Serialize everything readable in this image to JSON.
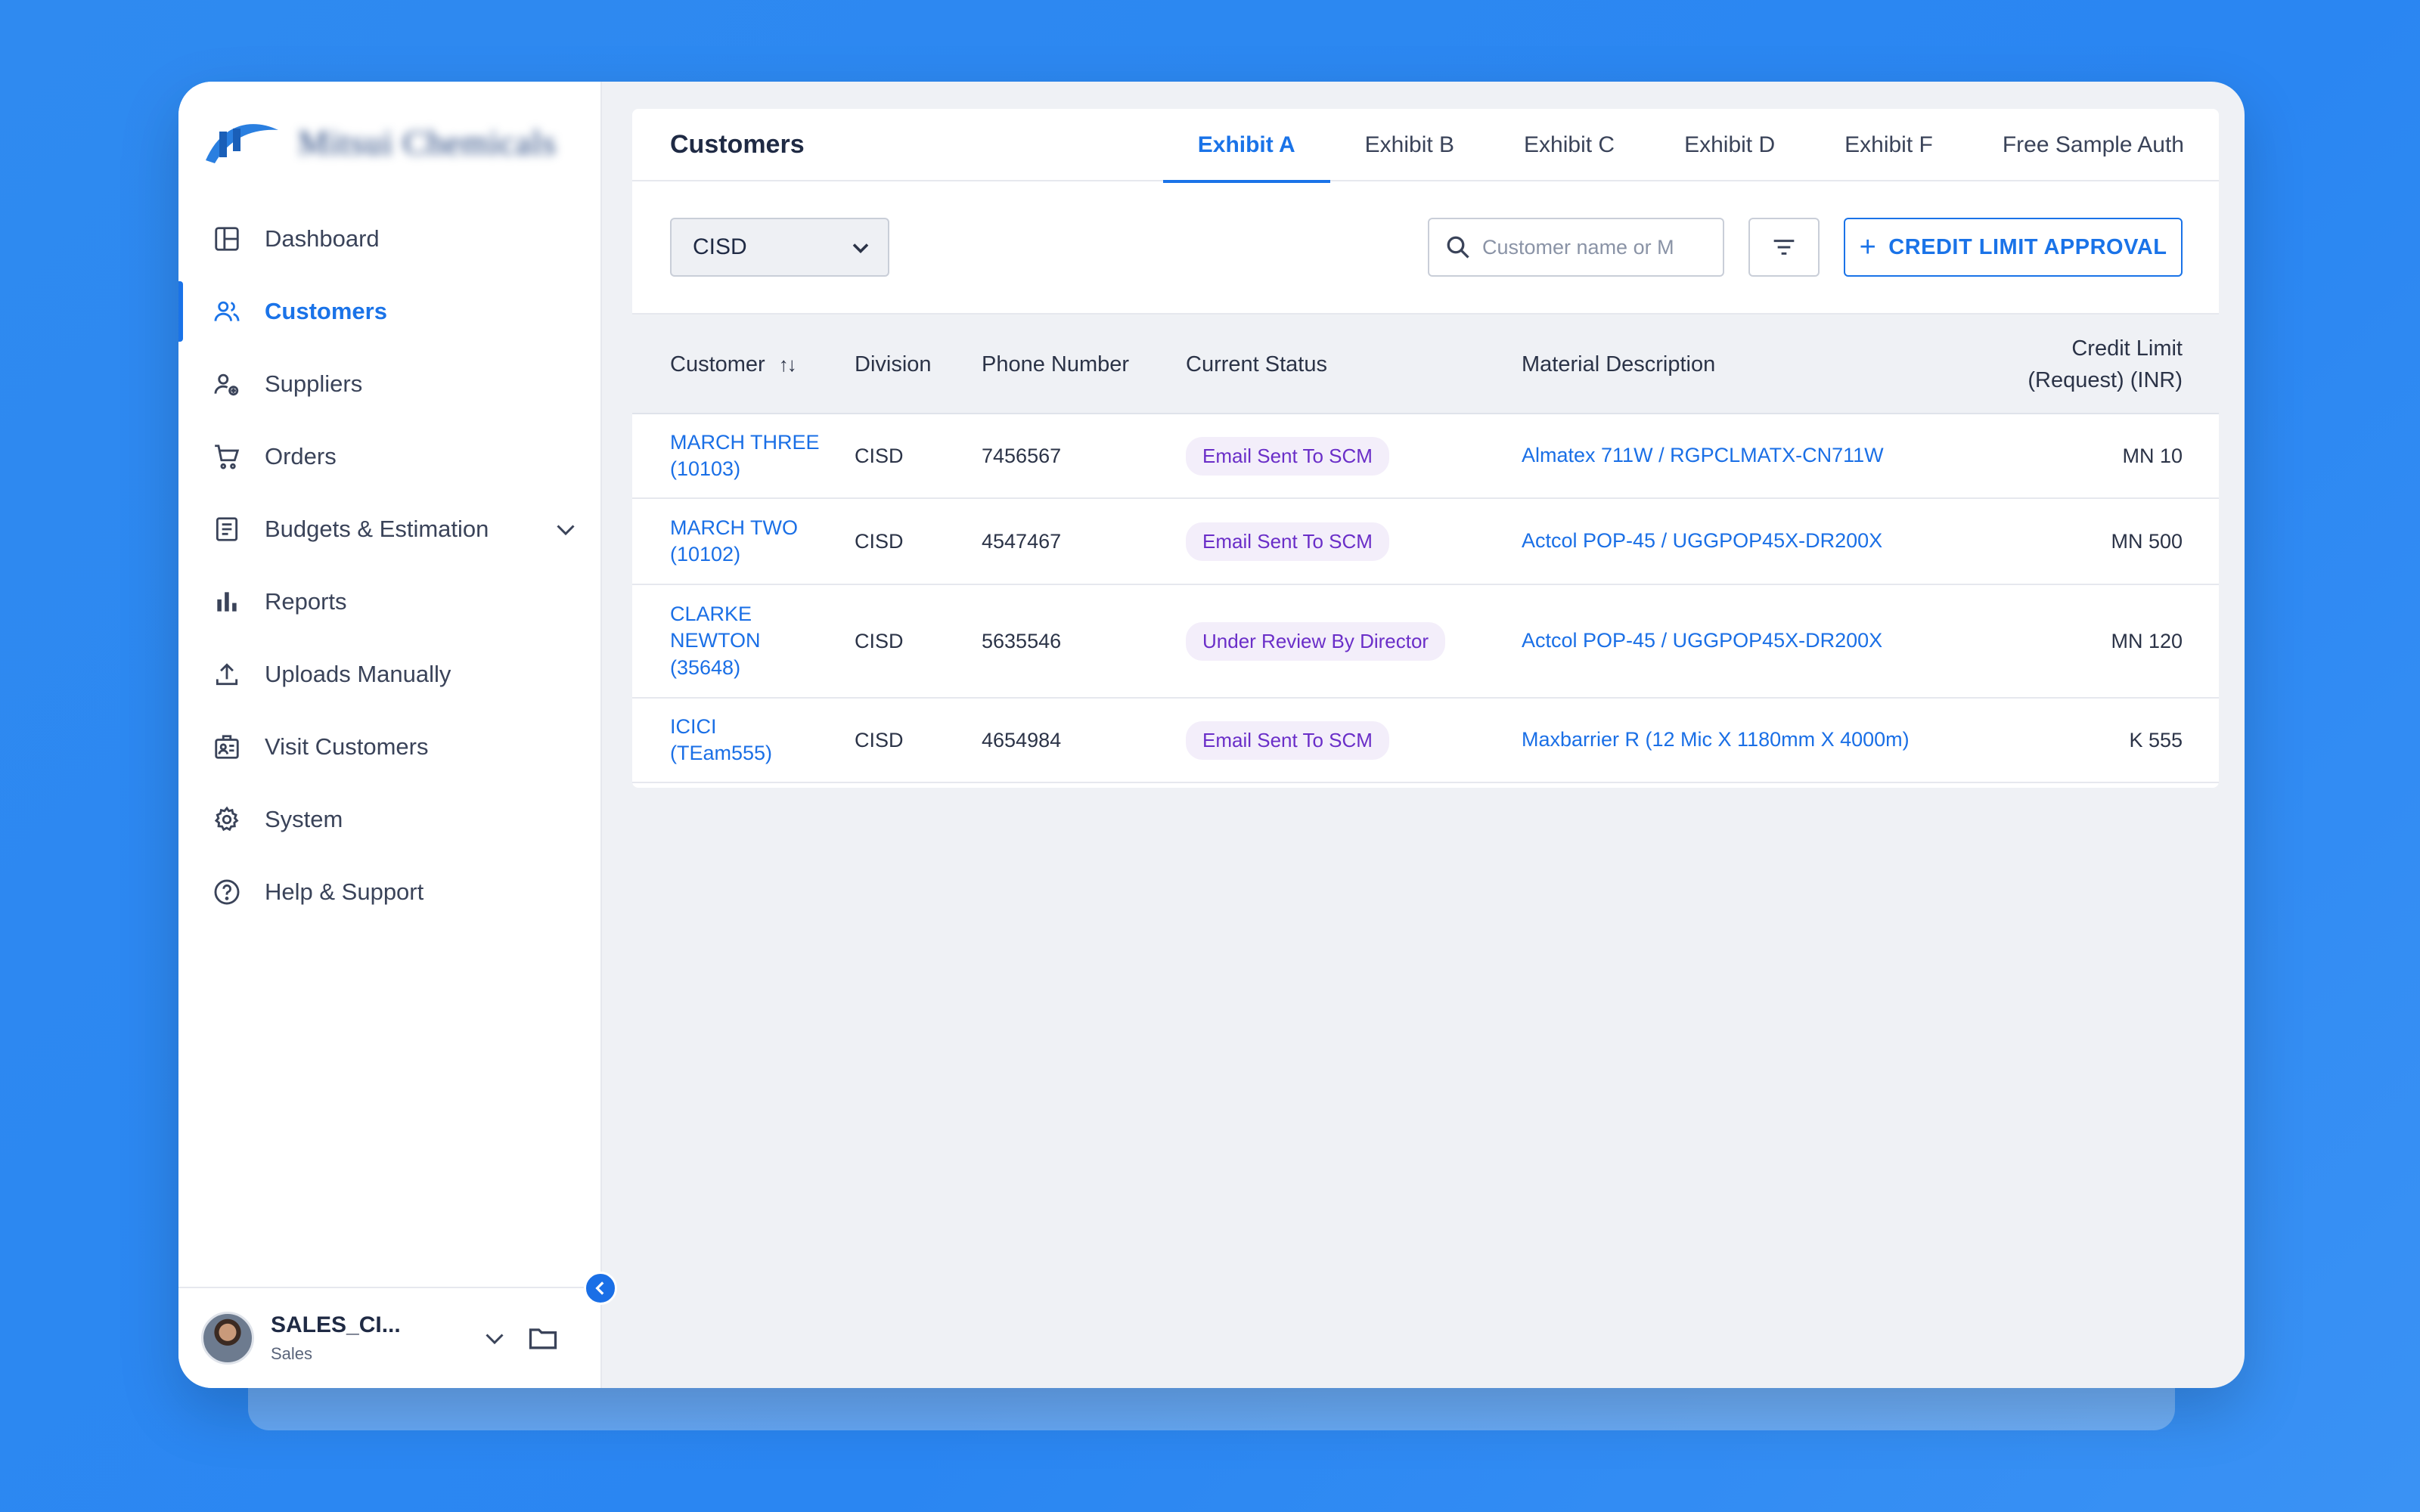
{
  "sidebar": {
    "brand": "Mitsui Chemicals",
    "items": [
      {
        "label": "Dashboard",
        "icon": "dashboard-icon"
      },
      {
        "label": "Customers",
        "icon": "users-icon",
        "active": true
      },
      {
        "label": "Suppliers",
        "icon": "supplier-icon"
      },
      {
        "label": "Orders",
        "icon": "cart-icon"
      },
      {
        "label": "Budgets & Estimation",
        "icon": "document-icon",
        "expandable": true
      },
      {
        "label": "Reports",
        "icon": "bar-chart-icon"
      },
      {
        "label": "Uploads Manually",
        "icon": "upload-icon"
      },
      {
        "label": "Visit Customers",
        "icon": "id-badge-icon"
      },
      {
        "label": "System",
        "icon": "gear-icon"
      },
      {
        "label": "Help & Support",
        "icon": "help-icon"
      }
    ],
    "user": {
      "name": "SALES_CI...",
      "role": "Sales"
    }
  },
  "header": {
    "title": "Customers",
    "tabs": [
      "Exhibit A",
      "Exhibit B",
      "Exhibit C",
      "Exhibit D",
      "Exhibit F",
      "Free Sample Auth"
    ],
    "active_tab": "Exhibit A"
  },
  "toolbar": {
    "division_select": "CISD",
    "search_placeholder": "Customer name or M",
    "primary_button": "CREDIT LIMIT APPROVAL"
  },
  "table": {
    "columns": {
      "customer": "Customer",
      "division": "Division",
      "phone": "Phone Number",
      "status": "Current Status",
      "material": "Material Description",
      "credit": "Credit Limit",
      "credit_sub": "(Request) (INR)"
    },
    "rows": [
      {
        "customer_name": "MARCH THREE",
        "customer_id": "(10103)",
        "division": "CISD",
        "phone": "7456567",
        "status": "Email Sent To SCM",
        "material": "Almatex 711W / RGPCLMATX-CN711W",
        "credit": "MN 10"
      },
      {
        "customer_name": "MARCH TWO",
        "customer_id": "(10102)",
        "division": "CISD",
        "phone": "4547467",
        "status": "Email Sent To SCM",
        "material": "Actcol POP-45 / UGGPOP45X-DR200X",
        "credit": "MN 500"
      },
      {
        "customer_name": "CLARKE NEWTON",
        "customer_id": "(35648)",
        "division": "CISD",
        "phone": "5635546",
        "status": "Under Review By Director",
        "material": "Actcol POP-45 / UGGPOP45X-DR200X",
        "credit": "MN 120"
      },
      {
        "customer_name": "ICICI",
        "customer_id": "(TEam555)",
        "division": "CISD",
        "phone": "4654984",
        "status": "Email Sent To SCM",
        "material": "Maxbarrier R (12 Mic X 1180mm X 4000m)",
        "credit": "K 555"
      }
    ]
  },
  "colors": {
    "accent": "#1a73e8",
    "background": "#2f8af0",
    "status_pill_bg": "#f3eefa",
    "status_pill_text": "#6a2ec8"
  }
}
